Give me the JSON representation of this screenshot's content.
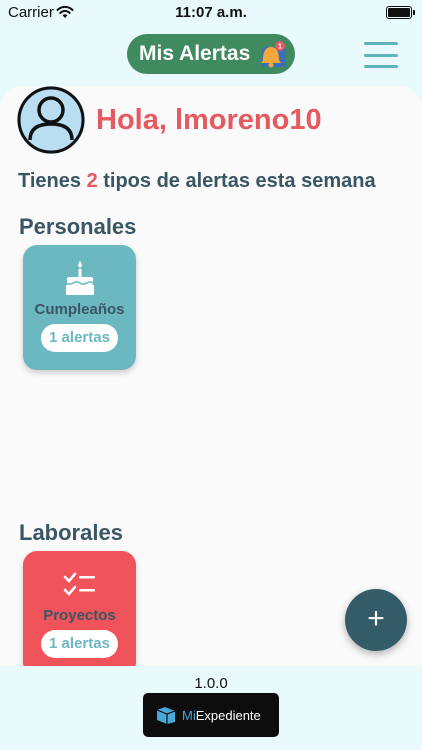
{
  "status_bar": {
    "carrier": "Carrier",
    "time": "11:07 a.m."
  },
  "header": {
    "logo_text": "Mis Alertas",
    "bell_badge": "1"
  },
  "greeting": "Hola, lmoreno10",
  "summary": {
    "prefix": "Tienes ",
    "count": "2",
    "suffix": " tipos de alertas esta semana"
  },
  "sections": [
    {
      "title": "Personales",
      "card": {
        "title": "Cumpleaños",
        "badge": "1 alertas",
        "icon": "cake-icon"
      }
    },
    {
      "title": "Laborales",
      "card": {
        "title": "Proyectos",
        "badge": "1 alertas",
        "icon": "checklist-icon"
      }
    }
  ],
  "fab_label": "+",
  "footer": {
    "version": "1.0.0",
    "brand_prefix": "Mi",
    "brand_suffix": "Expediente"
  },
  "colors": {
    "brand_green": "#3f8a5e",
    "accent_red": "#e55a60",
    "teal": "#6cb8c1",
    "dark_text": "#3a5563"
  }
}
